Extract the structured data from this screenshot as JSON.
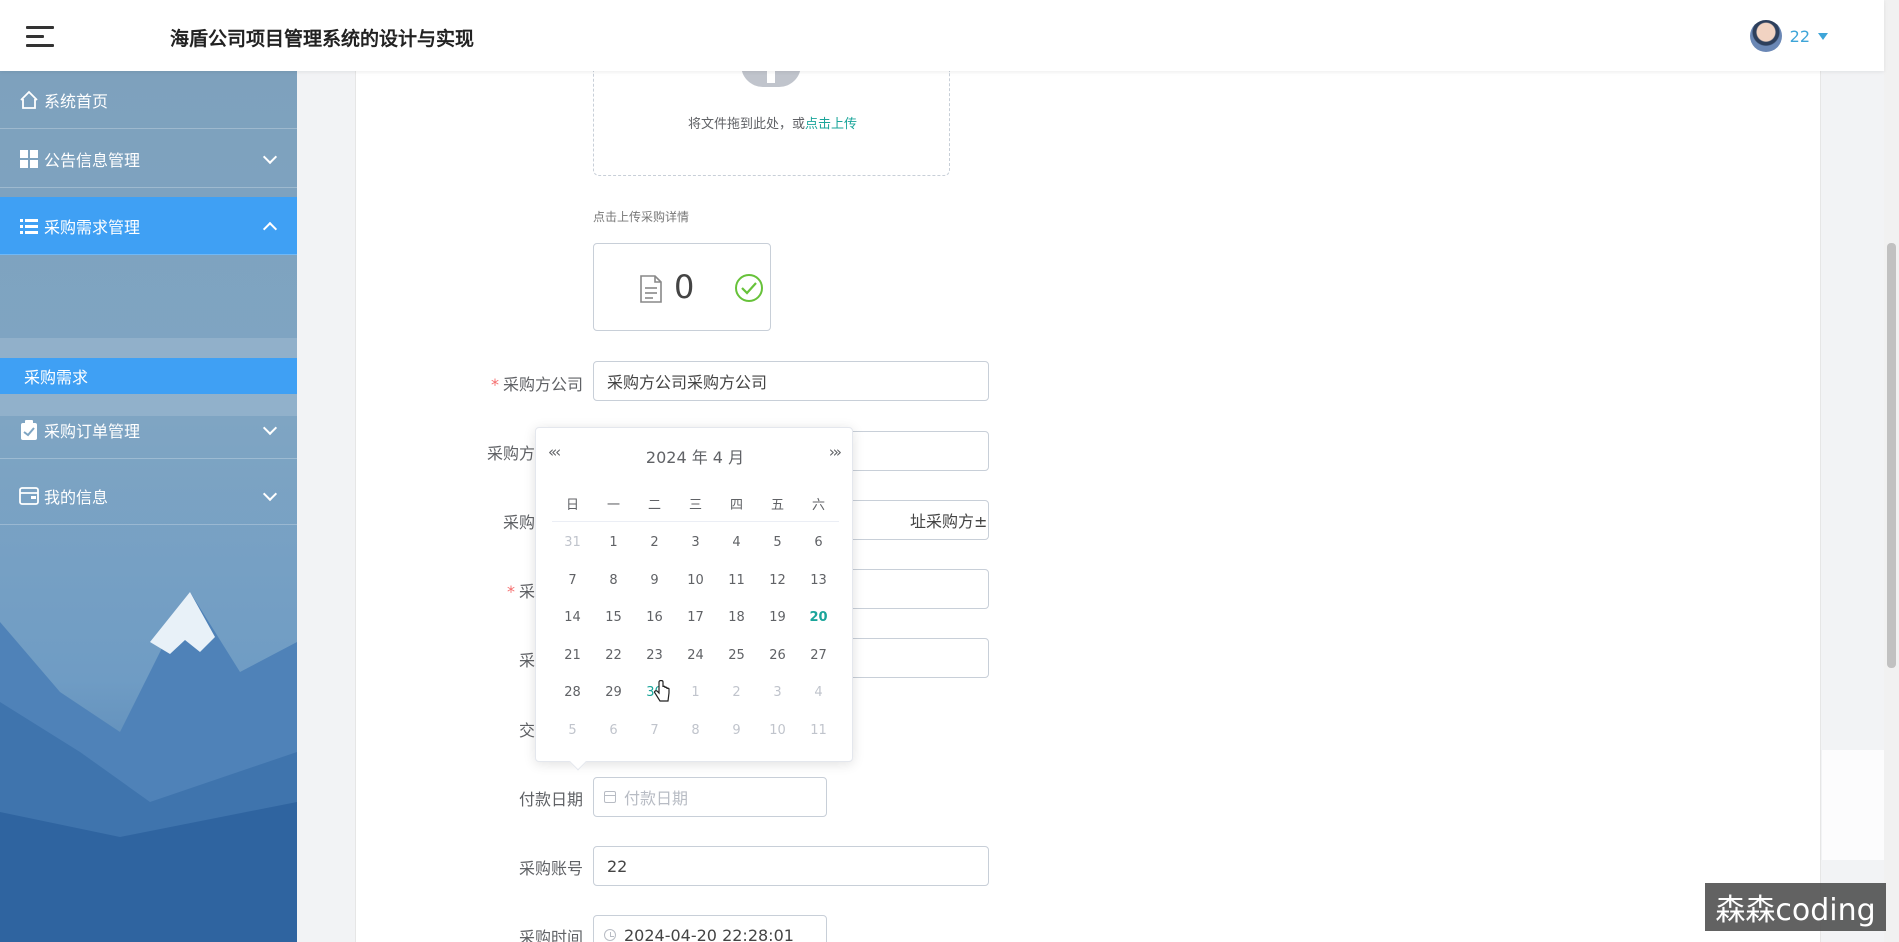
{
  "header": {
    "title": "海盾公司项目管理系统的设计与实现",
    "user": "22"
  },
  "sidebar": {
    "items": [
      {
        "label": "系统首页",
        "icon": "home-icon"
      },
      {
        "label": "公告信息管理",
        "icon": "grid-icon"
      },
      {
        "label": "采购需求管理",
        "icon": "list-icon",
        "expanded": true
      },
      {
        "label": "采购订单管理",
        "icon": "clipboard-icon"
      },
      {
        "label": "我的信息",
        "icon": "wallet-icon"
      }
    ],
    "sub_item": "采购需求"
  },
  "upload": {
    "text": "将文件拖到此处，或",
    "link": "点击上传",
    "tip": "点击上传采购详情",
    "file_count": "0"
  },
  "form": {
    "buyer_company_label": "采购方公司",
    "buyer_company_value": "采购方公司采购方公司",
    "buyer_contact_label": "采购方联系人",
    "buyer_address_label": "采购方地址",
    "buyer_address_value": "址采购方±",
    "amount_label": "采购金额",
    "equipment_label": "采购设备",
    "delivery_date_label": "交付日期",
    "payment_date_label": "付款日期",
    "payment_date_placeholder": "付款日期",
    "account_label": "采购账号",
    "account_value": "22",
    "purchase_time_label": "采购时间",
    "purchase_time_value": "2024-04-20 22:28:01"
  },
  "picker": {
    "header": "2024 年  4 月",
    "prev": "«‹",
    "next": "›»",
    "weekdays": [
      "日",
      "一",
      "二",
      "三",
      "四",
      "五",
      "六"
    ],
    "days": [
      {
        "d": "31",
        "s": "muted"
      },
      {
        "d": "1"
      },
      {
        "d": "2"
      },
      {
        "d": "3"
      },
      {
        "d": "4"
      },
      {
        "d": "5"
      },
      {
        "d": "6"
      },
      {
        "d": "7"
      },
      {
        "d": "8"
      },
      {
        "d": "9"
      },
      {
        "d": "10"
      },
      {
        "d": "11"
      },
      {
        "d": "12"
      },
      {
        "d": "13"
      },
      {
        "d": "14"
      },
      {
        "d": "15"
      },
      {
        "d": "16"
      },
      {
        "d": "17"
      },
      {
        "d": "18"
      },
      {
        "d": "19"
      },
      {
        "d": "20",
        "s": "today"
      },
      {
        "d": "21"
      },
      {
        "d": "22"
      },
      {
        "d": "23"
      },
      {
        "d": "24"
      },
      {
        "d": "25"
      },
      {
        "d": "26"
      },
      {
        "d": "27"
      },
      {
        "d": "28"
      },
      {
        "d": "29"
      },
      {
        "d": "30",
        "s": "hover"
      },
      {
        "d": "1",
        "s": "muted"
      },
      {
        "d": "2",
        "s": "muted"
      },
      {
        "d": "3",
        "s": "muted"
      },
      {
        "d": "4",
        "s": "muted"
      },
      {
        "d": "5",
        "s": "muted"
      },
      {
        "d": "6",
        "s": "muted"
      },
      {
        "d": "7",
        "s": "muted"
      },
      {
        "d": "8",
        "s": "muted"
      },
      {
        "d": "9",
        "s": "muted"
      },
      {
        "d": "10",
        "s": "muted"
      },
      {
        "d": "11",
        "s": "muted"
      }
    ]
  },
  "watermark": "森森coding",
  "colors": {
    "accent": "#3fa0f4",
    "link": "#1aa59a",
    "required": "#f56c6c",
    "user": "#3ea5d8"
  }
}
